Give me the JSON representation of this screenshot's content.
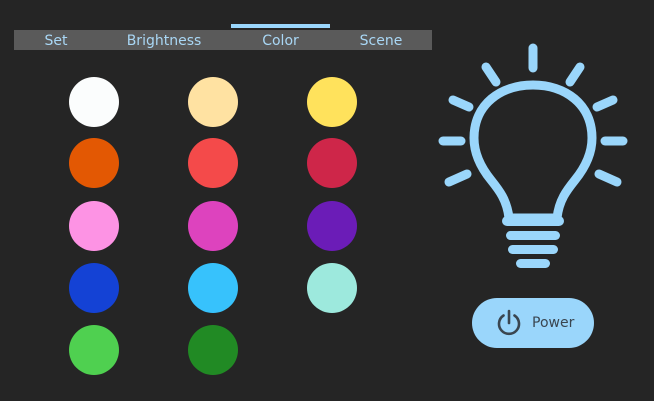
{
  "tabs": {
    "set": "Set",
    "brightness": "Brightness",
    "color": "Color",
    "scene": "Scene",
    "active": "Color"
  },
  "swatches": [
    {
      "name": "white",
      "color": "#fbfdfd"
    },
    {
      "name": "cream",
      "color": "#ffe2a2"
    },
    {
      "name": "yellow",
      "color": "#ffe25c"
    },
    {
      "name": "orange",
      "color": "#e35803"
    },
    {
      "name": "coral-red",
      "color": "#f44a4a"
    },
    {
      "name": "crimson",
      "color": "#ce2649"
    },
    {
      "name": "pink",
      "color": "#fd93e4"
    },
    {
      "name": "magenta",
      "color": "#dd43be"
    },
    {
      "name": "purple",
      "color": "#6b1cb7"
    },
    {
      "name": "blue",
      "color": "#1442d5"
    },
    {
      "name": "sky-blue",
      "color": "#37c2fc"
    },
    {
      "name": "mint",
      "color": "#9de9dd"
    },
    {
      "name": "green",
      "color": "#4fd050"
    },
    {
      "name": "dark-green",
      "color": "#218a24"
    }
  ],
  "bulb": {
    "icon": "lightbulb-icon",
    "color": "#9ad6fb"
  },
  "power": {
    "label": "Power",
    "icon": "power-icon",
    "background": "#9ad6fb"
  }
}
